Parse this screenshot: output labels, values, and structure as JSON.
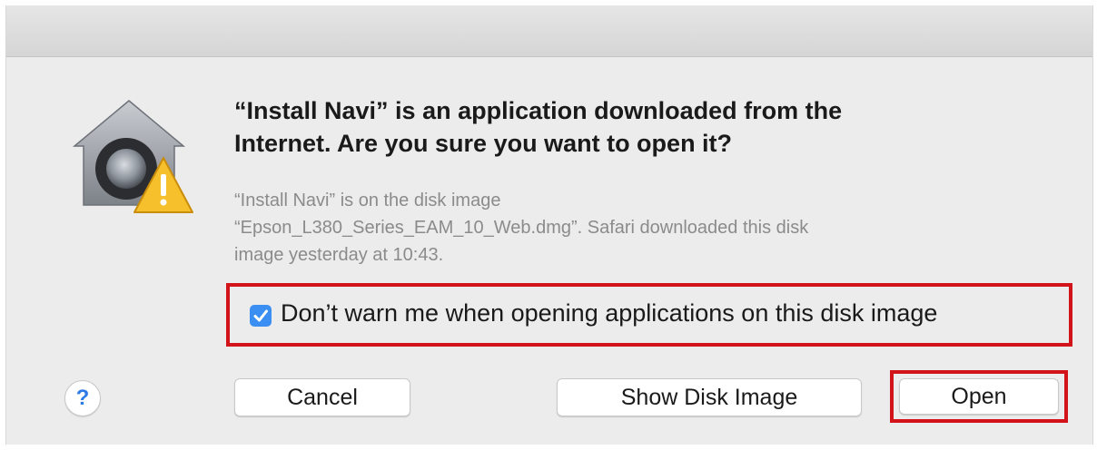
{
  "dialog": {
    "title_line1": "“Install Navi” is an application downloaded from the",
    "title_line2": "Internet. Are you sure you want to open it?",
    "message_line1": "“Install Navi” is on the disk image",
    "message_line2": "“Epson_L380_Series_EAM_10_Web.dmg”. Safari downloaded this disk",
    "message_line3": "image yesterday at 10:43.",
    "icon": "gatekeeper-warning-icon"
  },
  "warning_option": {
    "label": "Don’t warn me when opening applications on this disk image",
    "checked": true
  },
  "buttons": {
    "help": "?",
    "cancel": "Cancel",
    "show_disk_image": "Show Disk Image",
    "open": "Open"
  },
  "colors": {
    "highlight_border": "#d3131a",
    "checkbox_accent": "#3b8ff3",
    "help_accent": "#2e7be6"
  }
}
